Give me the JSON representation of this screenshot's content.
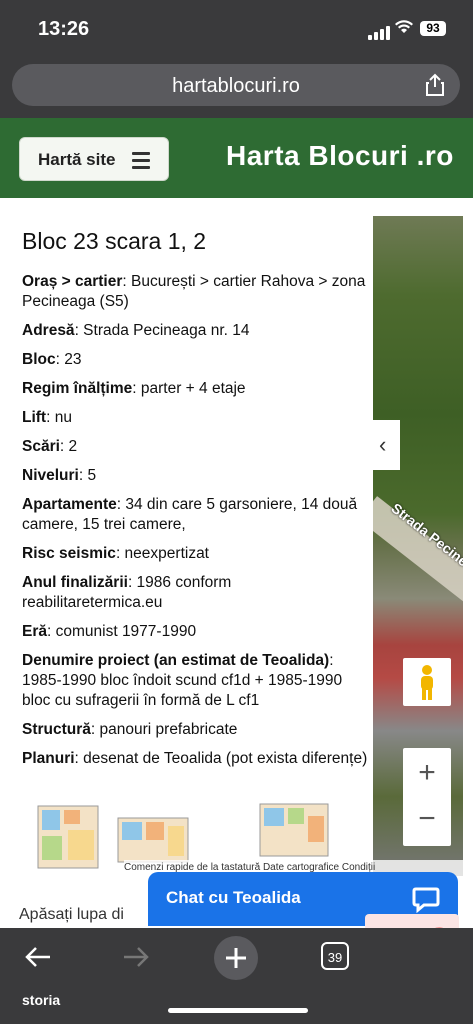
{
  "status": {
    "time": "13:26",
    "battery": "93"
  },
  "browser": {
    "url": "hartablocuri.ro",
    "tab_count": "39"
  },
  "header": {
    "menu_label": "Hartă site",
    "brand": "Harta Blocuri .ro"
  },
  "block": {
    "title": "Bloc 23 scara 1, 2",
    "rows": [
      {
        "label": "Oraș > cartier",
        "value": ": București > cartier Rahova > zona Pecineaga (S5)"
      },
      {
        "label": "Adresă",
        "value": ": Strada Pecineaga nr. 14"
      },
      {
        "label": "Bloc",
        "value": ": 23"
      },
      {
        "label": "Regim înălțime",
        "value": ": parter + 4 etaje"
      },
      {
        "label": "Lift",
        "value": ": nu"
      },
      {
        "label": "Scări",
        "value": ": 2"
      },
      {
        "label": "Niveluri",
        "value": ": 5"
      },
      {
        "label": "Apartamente",
        "value": ": 34 din care 5 garsoniere, 14 două camere, 15 trei camere,"
      },
      {
        "label": "Risc seismic",
        "value": ": neexpertizat"
      },
      {
        "label": "Anul finalizării",
        "value": ": 1986 conform reabilitaretermica.eu"
      },
      {
        "label": "Eră",
        "value": ": comunist 1977-1990"
      },
      {
        "label": "Denumire proiect (an estimat de Teoalida)",
        "value": ": 1985-1990 bloc îndoit scund cf1d + 1985-1990 bloc cu sufragerii în formă de L cf1"
      },
      {
        "label": "Structură",
        "value": ": panouri prefabricate"
      },
      {
        "label": "Planuri",
        "value": ": desenat de Teoalida (pot exista diferențe)"
      }
    ]
  },
  "map": {
    "road_label": "Strada Pecineaga",
    "attribution": "Comenzi rapide de la tastatură   Date cartografice   Condiții",
    "zoom_in": "+",
    "zoom_out": "−",
    "toggle": "‹"
  },
  "chat": {
    "label": "Chat cu Teoalida"
  },
  "page": {
    "bottom_text": "Apăsați lupa di"
  },
  "toolbar": {
    "label": "storia"
  }
}
